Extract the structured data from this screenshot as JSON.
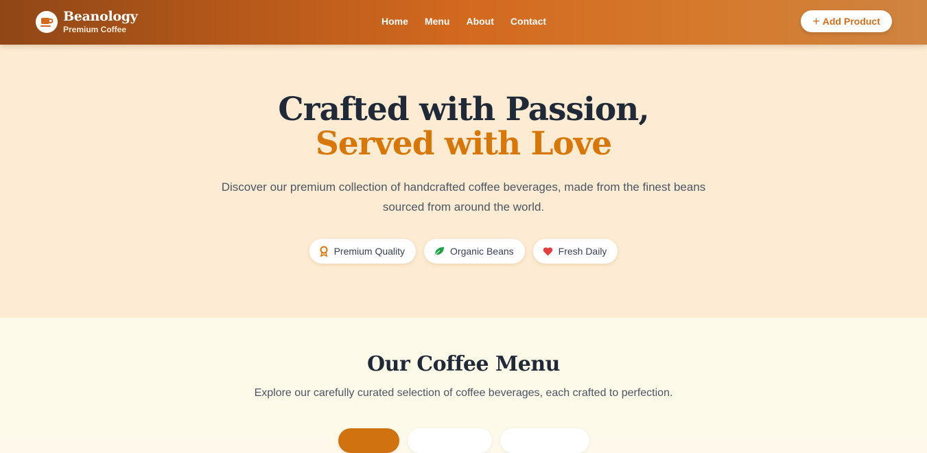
{
  "header": {
    "brand_name": "Beanology",
    "brand_sub": "Premium Coffee",
    "nav": [
      "Home",
      "Menu",
      "About",
      "Contact"
    ],
    "add_button": "Add Product"
  },
  "hero": {
    "title_line1": "Crafted with Passion,",
    "title_line2": "Served with Love",
    "description": "Discover our premium collection of handcrafted coffee beverages, made from the finest beans sourced from around the world.",
    "badges": [
      {
        "label": "Premium Quality",
        "icon": "award-icon",
        "color": "#d97706"
      },
      {
        "label": "Organic Beans",
        "icon": "leaf-icon",
        "color": "#16a34a"
      },
      {
        "label": "Fresh Daily",
        "icon": "heart-icon",
        "color": "#dc2626"
      }
    ]
  },
  "menu": {
    "title": "Our Coffee Menu",
    "description": "Explore our carefully curated selection of coffee beverages, each crafted to perfection."
  },
  "colors": {
    "accent": "#d97706",
    "header_start": "#8f4716",
    "header_end": "#cf8440",
    "hero_bg": "#fdecd3",
    "section_bg": "#fefaea"
  }
}
